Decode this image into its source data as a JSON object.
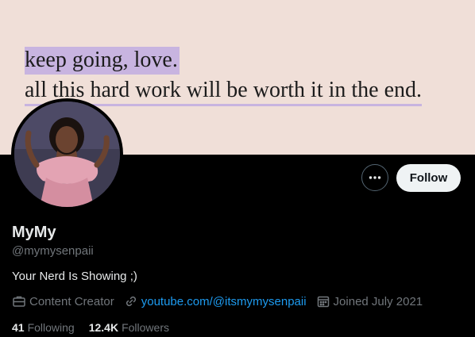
{
  "banner": {
    "line1": "keep going, love.",
    "line2": "all this hard work will be worth it in the end."
  },
  "profile": {
    "display_name": "MyMy",
    "handle": "@mymysenpaii",
    "bio": "Your Nerd Is Showing ;)",
    "category": "Content Creator",
    "website": "youtube.com/@itsmymysenpaii",
    "joined": "Joined July 2021",
    "following_count": "41",
    "following_label": "Following",
    "followers_count": "12.4K",
    "followers_label": "Followers"
  },
  "actions": {
    "follow_label": "Follow",
    "more_icon": "more-horizontal-icon"
  },
  "colors": {
    "background": "#000000",
    "banner": "#f0dfd8",
    "highlight": "#c8b4e0",
    "link": "#1d9bf0",
    "muted": "#71767b"
  }
}
